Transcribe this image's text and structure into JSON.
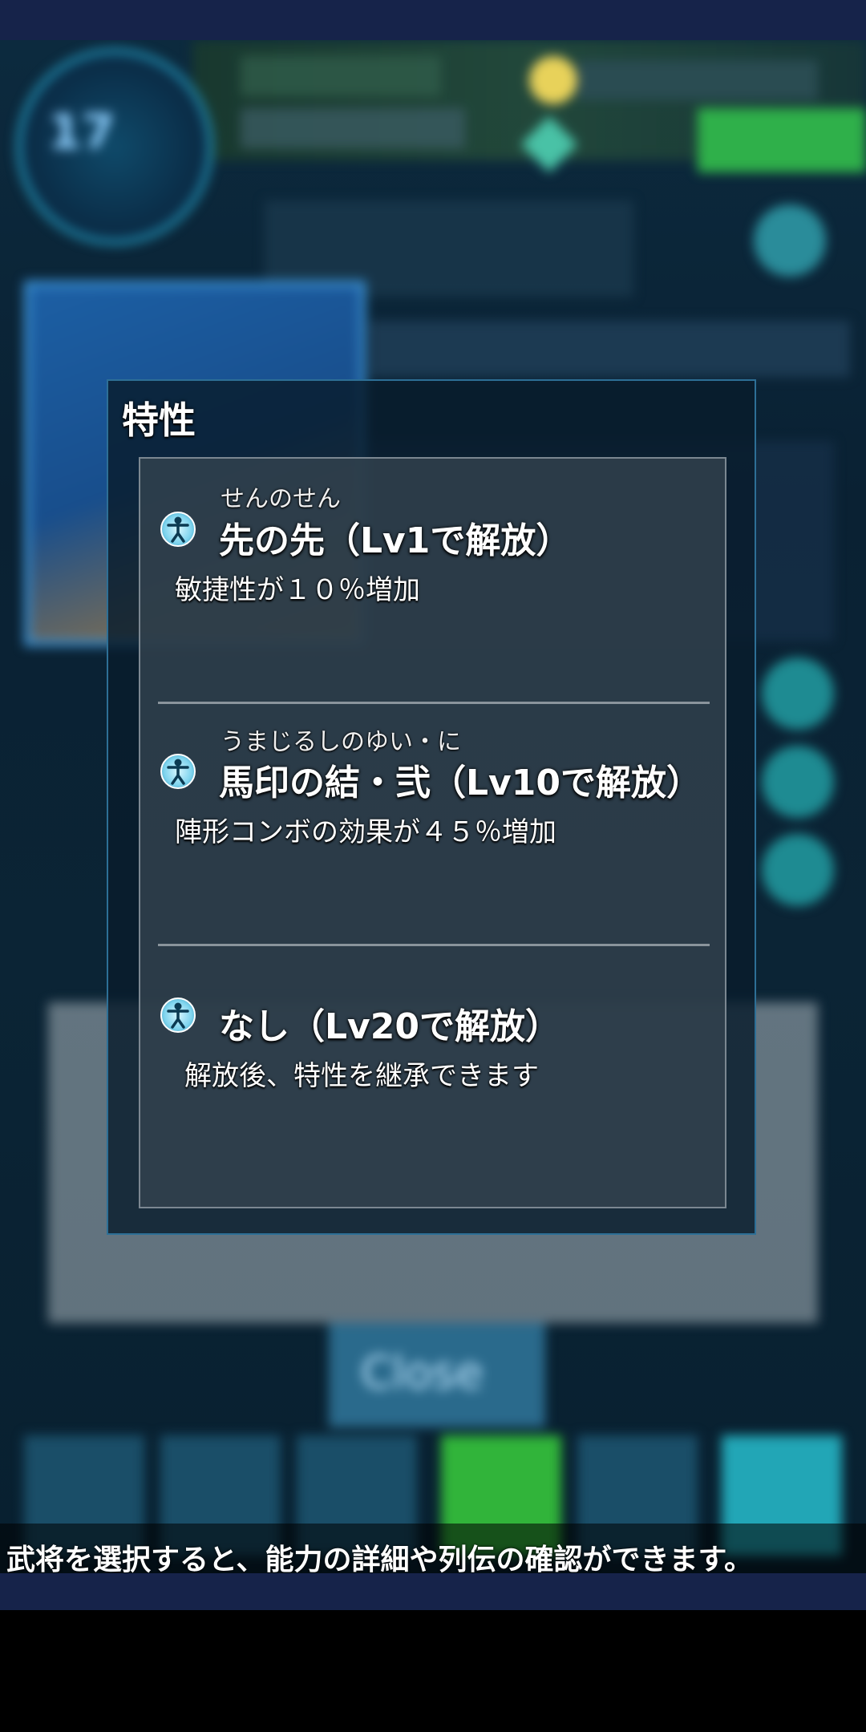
{
  "dialog": {
    "title": "特性",
    "traits": [
      {
        "ruby": "せんのせん",
        "title": "先の先（Lv1で解放）",
        "description": "敏捷性が１０％増加",
        "icon": "trait-figure-icon"
      },
      {
        "ruby": "うまじるしのゆい・に",
        "title": "馬印の結・弐（Lv10で解放）",
        "description": "陣形コンボの効果が４５％増加",
        "icon": "trait-figure-icon"
      },
      {
        "ruby": "",
        "title": "なし（Lv20で解放）",
        "description": "解放後、特性を継承できます",
        "icon": "trait-figure-icon"
      }
    ]
  },
  "background": {
    "level": "17",
    "close_label": "Close"
  },
  "hint": {
    "text": "武将を選択すると、能力の詳細や列伝の確認ができます。"
  }
}
